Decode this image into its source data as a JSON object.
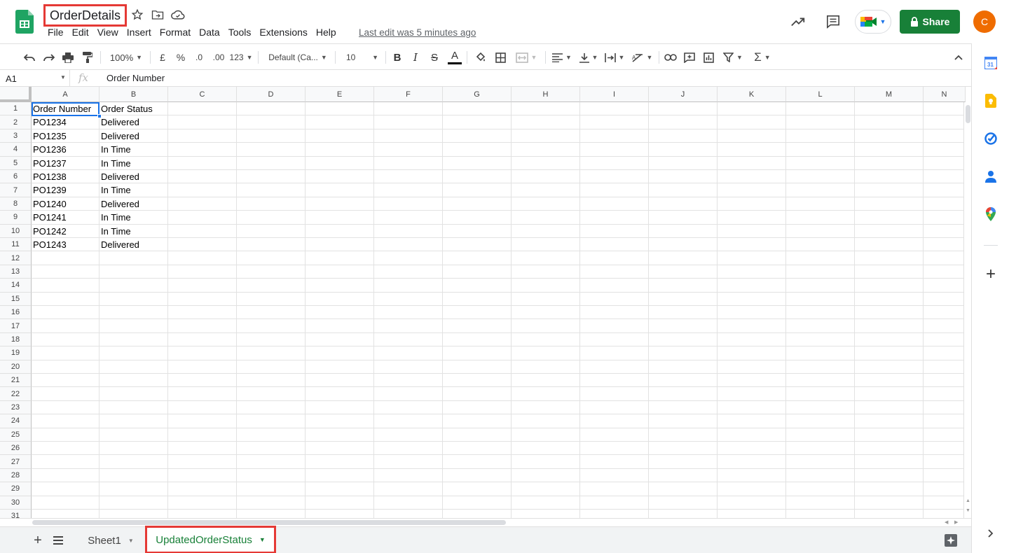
{
  "header": {
    "title": "OrderDetails",
    "menu": [
      "File",
      "Edit",
      "View",
      "Insert",
      "Format",
      "Data",
      "Tools",
      "Extensions",
      "Help"
    ],
    "last_edit": "Last edit was 5 minutes ago",
    "share_label": "Share",
    "avatar_initial": "C"
  },
  "toolbar": {
    "zoom": "100%",
    "currency": "£",
    "percent": "%",
    "dec_less": ".0",
    "dec_more": ".00",
    "more_formats": "123",
    "font": "Default (Ca...",
    "font_size": "10",
    "bold": "B",
    "italic": "I",
    "strike": "S",
    "text_color": "A",
    "sigma": "Σ"
  },
  "formula_bar": {
    "cell_ref": "A1",
    "fx": "fx",
    "value": "Order Number"
  },
  "columns": [
    "A",
    "B",
    "C",
    "D",
    "E",
    "F",
    "G",
    "H",
    "I",
    "J",
    "K",
    "L",
    "M",
    "N"
  ],
  "rows": [
    "1",
    "2",
    "3",
    "4",
    "5",
    "6",
    "7",
    "8",
    "9",
    "10",
    "11",
    "12",
    "13",
    "14",
    "15",
    "16",
    "17",
    "18",
    "19",
    "20",
    "21",
    "22",
    "23",
    "24",
    "25",
    "26",
    "27",
    "28",
    "29",
    "30",
    "31"
  ],
  "table": {
    "headers": [
      "Order Number",
      "Order Status"
    ],
    "rows": [
      [
        "PO1234",
        "Delivered"
      ],
      [
        "PO1235",
        "Delivered"
      ],
      [
        "PO1236",
        "In Time"
      ],
      [
        "PO1237",
        "In Time"
      ],
      [
        "PO1238",
        "Delivered"
      ],
      [
        "PO1239",
        "In Time"
      ],
      [
        "PO1240",
        "Delivered"
      ],
      [
        "PO1241",
        "In Time"
      ],
      [
        "PO1242",
        "In Time"
      ],
      [
        "PO1243",
        "Delivered"
      ]
    ]
  },
  "sheets": {
    "tabs": [
      "Sheet1",
      "UpdatedOrderStatus"
    ],
    "active": "UpdatedOrderStatus"
  },
  "colors": {
    "accent_green": "#188038",
    "highlight_red": "#e53935",
    "selection_blue": "#1a73e8",
    "avatar": "#ef6c00"
  }
}
